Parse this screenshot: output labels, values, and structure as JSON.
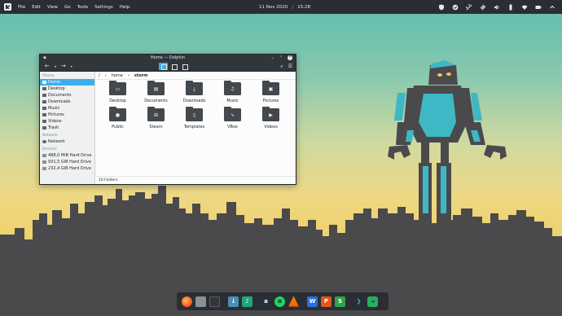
{
  "top_panel": {
    "menu": [
      "File",
      "Edit",
      "View",
      "Go",
      "Tools",
      "Settings",
      "Help"
    ],
    "date": "11 Nov 2020",
    "time": "15:28"
  },
  "window": {
    "title": "Home — Dolphin",
    "breadcrumb": [
      "/",
      "home",
      "storm"
    ],
    "sidebar": {
      "places_header": "Places",
      "places": [
        "Home",
        "Desktop",
        "Documents",
        "Downloads",
        "Music",
        "Pictures",
        "Videos",
        "Trash"
      ],
      "network_header": "Network",
      "network": [
        "Network"
      ],
      "devices_header": "Devices",
      "devices": [
        "488,0 MiB Hard Drive",
        "931,5 GiB Hard Drive",
        "232,4 GiB Hard Drive"
      ]
    },
    "items": [
      "Desktop",
      "Documents",
      "Downloads",
      "Music",
      "Pictures",
      "Public",
      "Steam",
      "Templates",
      "VBox",
      "Videos"
    ],
    "status": "10 Folders"
  },
  "dock": {
    "apps": [
      "firefox-icon",
      "file-manager-icon",
      "terminal-icon",
      "downloads-icon",
      "cantata-icon",
      "amazon-icon",
      "spotify-icon",
      "vlc-icon",
      "wps-writer-icon",
      "wps-presentation-icon",
      "wps-spreadsheet-icon",
      "vscode-icon",
      "kdeconnect-icon"
    ]
  },
  "colors": {
    "accent": "#3daee9",
    "panel": "#2a2e32",
    "robot_cyan": "#3fb8c6",
    "silhouette": "#4a4a4c"
  }
}
